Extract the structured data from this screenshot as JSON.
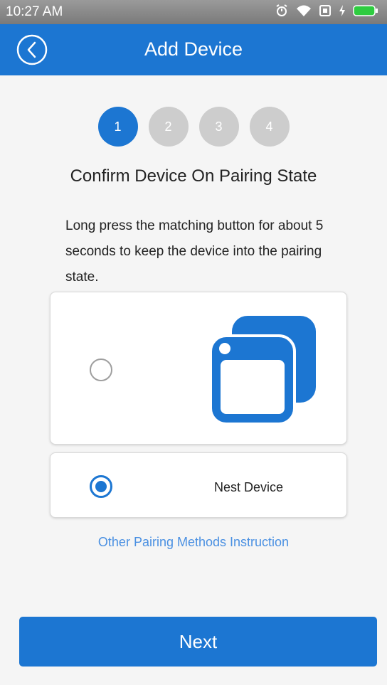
{
  "status_bar": {
    "time": "10:27 AM",
    "icons": [
      "alarm-icon",
      "wifi-icon",
      "sim-icon",
      "charging-icon",
      "battery-icon"
    ]
  },
  "app_bar": {
    "title": "Add Device",
    "back_icon": "back-circle-icon"
  },
  "steps": [
    {
      "label": "1",
      "active": true
    },
    {
      "label": "2",
      "active": false
    },
    {
      "label": "3",
      "active": false
    },
    {
      "label": "4",
      "active": false
    }
  ],
  "heading": "Confirm Device On Pairing State",
  "instruction": "Long press the matching button for about 5 seconds to keep the device into the pairing state.",
  "options": [
    {
      "label": "",
      "icon": "device-window-icon",
      "selected": false
    },
    {
      "label": "Nest Device",
      "icon": "",
      "selected": true
    }
  ],
  "other_link": "Other Pairing Methods Instruction",
  "next_button": "Next",
  "colors": {
    "primary": "#1c76d2",
    "inactive_step": "#cdcdcd",
    "link": "#4a90e2",
    "background": "#f5f5f5"
  }
}
